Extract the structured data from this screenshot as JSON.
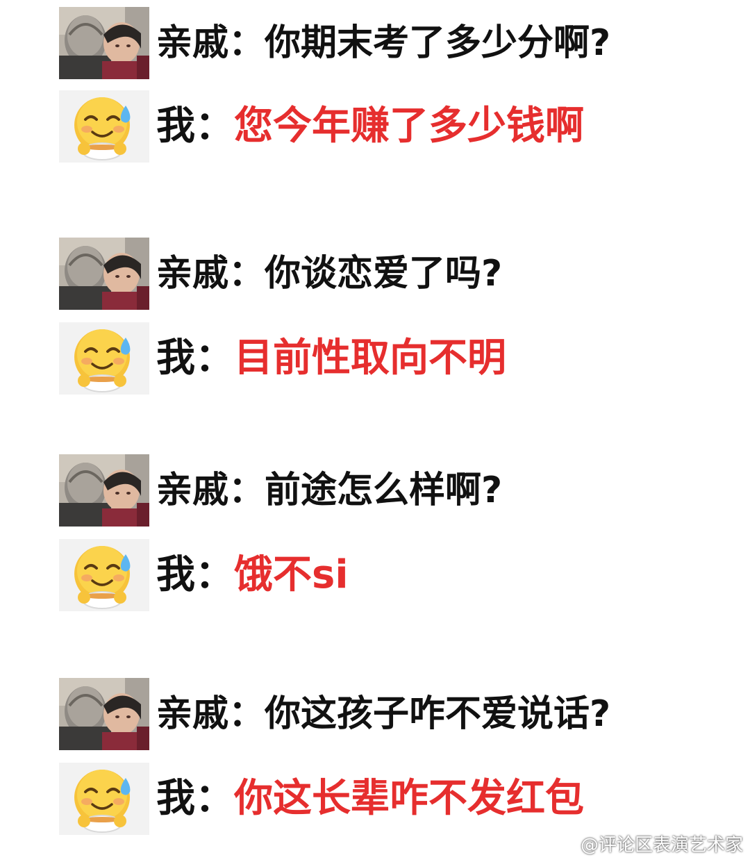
{
  "colors": {
    "question_text": "#111111",
    "answer_text": "#e62e2e",
    "watermark_text": "#ffffff"
  },
  "exchanges": [
    {
      "relative_label": "亲戚：",
      "question": "你期末考了多少分啊?",
      "me_label": "我：",
      "answer": "您今年赚了多少钱啊"
    },
    {
      "relative_label": "亲戚：",
      "question": "你谈恋爱了吗?",
      "me_label": "我：",
      "answer": "目前性取向不明"
    },
    {
      "relative_label": "亲戚：",
      "question": "前途怎么样啊?",
      "me_label": "我：",
      "answer": "饿不si"
    },
    {
      "relative_label": "亲戚：",
      "question": "你这孩子咋不爱说话?",
      "me_label": "我：",
      "answer": "你这长辈咋不发红包"
    }
  ],
  "watermark": {
    "icon": "weibo-icon",
    "text": "@评论区表演艺术家"
  }
}
